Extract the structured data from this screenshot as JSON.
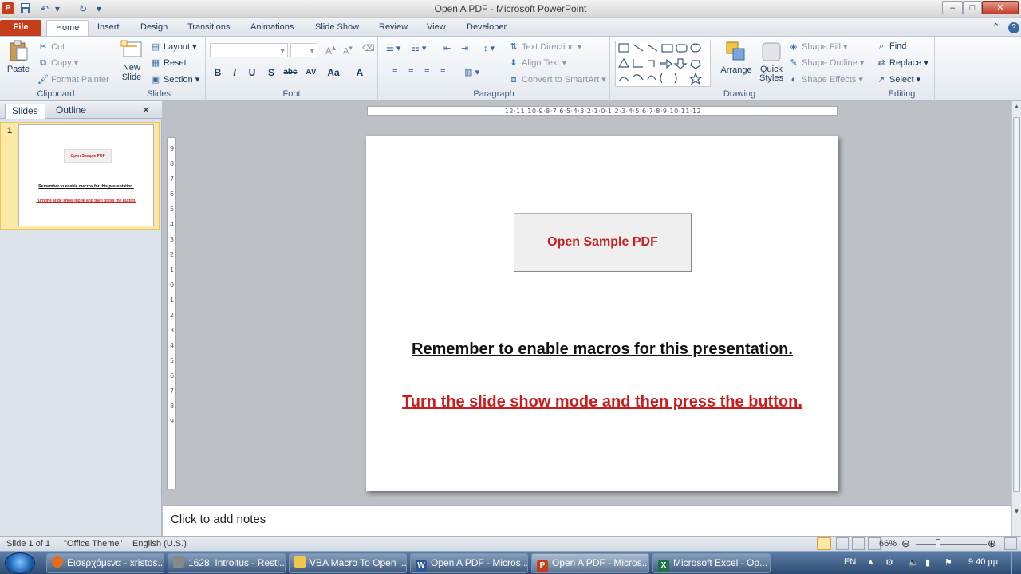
{
  "app": {
    "icon_letter": "P",
    "title": "Open A PDF - Microsoft PowerPoint"
  },
  "qat": {
    "save_icon": "save-icon",
    "undo_icon": "undo-icon",
    "redo_icon": "redo-icon"
  },
  "window_buttons": {
    "minimize": "–",
    "maximize": "□",
    "close": "✕"
  },
  "tabs": [
    "File",
    "Home",
    "Insert",
    "Design",
    "Transitions",
    "Animations",
    "Slide Show",
    "Review",
    "View",
    "Developer"
  ],
  "ribbon": {
    "clipboard": {
      "label": "Clipboard",
      "paste": "Paste",
      "cut": "Cut",
      "copy": "Copy",
      "format_painter": "Format Painter"
    },
    "slides": {
      "label": "Slides",
      "new_slide": "New Slide",
      "layout": "Layout",
      "reset": "Reset",
      "section": "Section"
    },
    "font": {
      "label": "Font",
      "buttons": [
        "B",
        "I",
        "U",
        "S",
        "abc",
        "AV",
        "Aa",
        "A"
      ]
    },
    "paragraph": {
      "label": "Paragraph",
      "text_direction": "Text Direction",
      "align_text": "Align Text",
      "convert_smartart": "Convert to SmartArt"
    },
    "drawing": {
      "label": "Drawing",
      "arrange": "Arrange",
      "quick_styles": "Quick Styles",
      "shape_fill": "Shape Fill",
      "shape_outline": "Shape Outline",
      "shape_effects": "Shape Effects"
    },
    "editing": {
      "label": "Editing",
      "find": "Find",
      "replace": "Replace",
      "select": "Select"
    }
  },
  "panel": {
    "tab_slides": "Slides",
    "tab_outline": "Outline",
    "slide_number": "1"
  },
  "slide": {
    "button_text": "Open Sample PDF",
    "line1": "Remember to enable macros for this presentation.",
    "line2": "Turn the slide show mode and then press the button."
  },
  "thumbnail": {
    "button_text": "Open Sample PDF",
    "line1": "Remember to enable macros for this presentation.",
    "line2": "Turn the slide show mode and then press the button."
  },
  "notes": {
    "placeholder": "Click to add notes"
  },
  "status": {
    "slide": "Slide 1 of 1",
    "theme": "\"Office Theme\"",
    "language": "English (U.S.)",
    "zoom": "66%",
    "zoom_level": 0.66
  },
  "taskbar": {
    "items": [
      {
        "label": "Εισερχόμενα - xristos...",
        "icon": "firefox-icon"
      },
      {
        "label": "1628. Introitus - Restl...",
        "icon": "app-icon"
      },
      {
        "label": "VBA Macro To Open ...",
        "icon": "folder-icon"
      },
      {
        "label": "Open A PDF - Micros...",
        "icon": "word-icon"
      },
      {
        "label": "Open A PDF - Micros...",
        "icon": "powerpoint-icon"
      },
      {
        "label": "Microsoft Excel - Op...",
        "icon": "excel-icon"
      }
    ],
    "lang": "EN",
    "time": "9:40 μμ"
  },
  "colors": {
    "accent_red": "#c81e1e",
    "file_tab": "#c43e1c",
    "selection": "#fce9a5"
  }
}
